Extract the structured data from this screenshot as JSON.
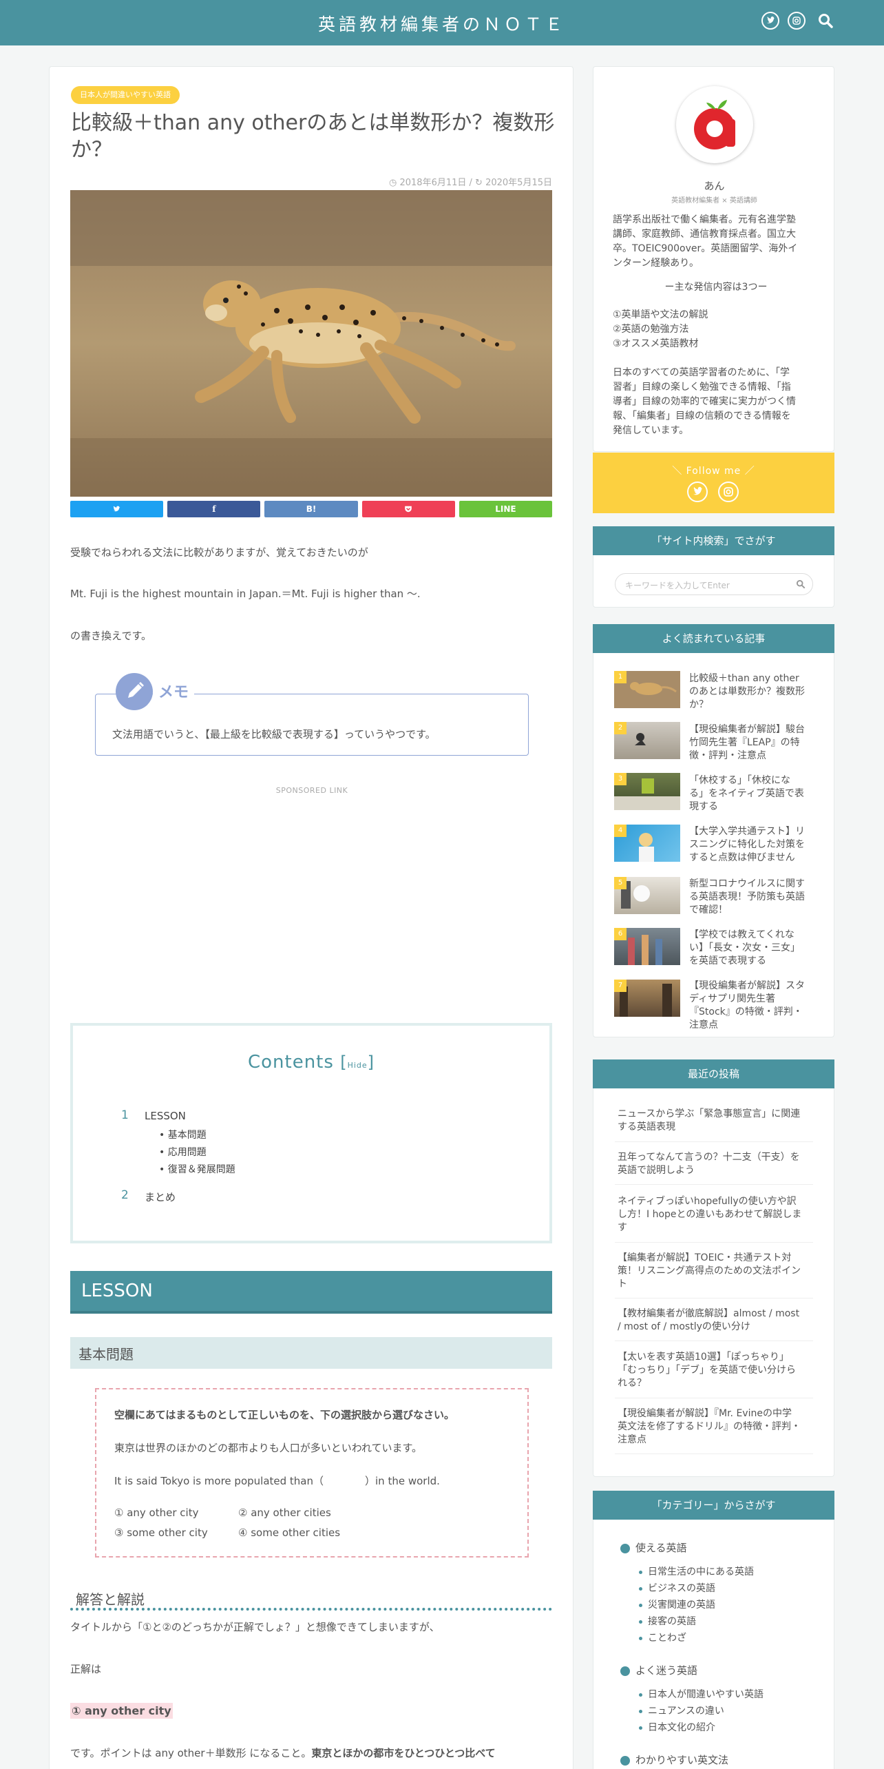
{
  "header": {
    "site_title": "英語教材編集者のＮＯＴＥ",
    "icons": [
      "twitter-icon",
      "instagram-icon",
      "search-icon"
    ]
  },
  "post": {
    "category": "日本人が間違いやすい英語",
    "title_line1": "比較級＋than any otherのあとは単数形か？複数形",
    "title_line2": "か？",
    "published": "2018年6月11日",
    "updated": "2020年5月15日",
    "share": [
      {
        "label": "",
        "icon": "twitter-icon",
        "color": "#1da1f2"
      },
      {
        "label": "",
        "icon": "facebook-icon",
        "color": "#3b5998"
      },
      {
        "label": "B!",
        "icon": "hatena-icon",
        "color": "#5d8ac1"
      },
      {
        "label": "",
        "icon": "pocket-icon",
        "color": "#ef4056"
      },
      {
        "label": "LINE",
        "icon": "line-icon",
        "color": "#6ac33b"
      }
    ],
    "intro1": "受験でねらわれる文法に比較がありますが、覚えておきたいのが",
    "intro2": "Mt. Fuji is the highest mountain in Japan.＝Mt. Fuji is higher than ～.",
    "intro3": "の書き換えです。",
    "memo_label": "メモ",
    "memo_text": "文法用語でいうと、【最上級を比較級で表現する】っていうやつです。",
    "sponsored": "SPONSORED LINK"
  },
  "toc": {
    "title": "Contents",
    "hide": "Hide",
    "items": [
      {
        "num": "1",
        "label": "LESSON",
        "subs": [
          "基本問題",
          "応用問題",
          "復習＆発展問題"
        ]
      },
      {
        "num": "2",
        "label": "まとめ",
        "subs": []
      }
    ]
  },
  "lesson": {
    "heading": "LESSON",
    "subheading": "基本問題",
    "question": "空欄にあてはまるものとして正しいものを、下の選択肢から選びなさい。",
    "sentence_jp": "東京は世界のほかのどの都市よりも人口が多いといわれています。",
    "sentence_en": "It is said Tokyo is more populated than（　　　　）in the world.",
    "choices": [
      "① any other city",
      "② any other cities",
      "③ some other city",
      "④ some other cities"
    ],
    "answer_heading": "解答と解説",
    "exp1": "タイトルから「①と②のどっちかが正解でしょ？」と想像できてしまいますが、",
    "exp2": "正解は",
    "answer": "① any other city",
    "exp3_normal": "です。ポイントは any other＋単数形 になること。",
    "exp3_bold": "東京とほかの都市をひとつひとつ比べて"
  },
  "sidebar": {
    "profile": {
      "name": "あん",
      "role": "英語教材編集者 × 英語講師",
      "bio": [
        "語学系出版社で働く編集者。元有名進学塾",
        "講師、家庭教師、通信教育採点者。国立大",
        "卒。TOEIC900over。英語圏留学、海外イ",
        "ンターン経験あり。"
      ],
      "main_title": "ー主な発信内容は3つー",
      "points": [
        "①英単語や文法の解説",
        "②英語の勉強方法",
        "③オススメ英語教材"
      ],
      "mission": [
        "日本のすべての英語学習者のために、「学",
        "習者」目線の楽しく勉強できる情報、「指",
        "導者」目線の効率的で確実に実力がつく情",
        "報、「編集者」目線の信頼のできる情報を",
        "発信しています。"
      ],
      "follow": "＼ Follow me ／"
    },
    "search": {
      "heading": "「サイト内検索」でさがす",
      "placeholder": "キーワードを入力してEnter"
    },
    "popular": {
      "heading": "よく読まれている記事",
      "items": [
        {
          "rank": "1",
          "lines": [
            "比較級＋than any other",
            "のあとは単数形か？複数形",
            "か？"
          ]
        },
        {
          "rank": "2",
          "lines": [
            "【現役編集者が解説】駿台",
            "竹岡先生著『LEAP』の特",
            "徴・評判・注意点"
          ]
        },
        {
          "rank": "3",
          "lines": [
            "「休校する」「休校にな",
            "る」をネイティブ英語で表",
            "現する"
          ]
        },
        {
          "rank": "4",
          "lines": [
            "【大学入学共通テスト】リ",
            "スニングに特化した対策を",
            "すると点数は伸びません"
          ]
        },
        {
          "rank": "5",
          "lines": [
            "新型コロナウイルスに関す",
            "る英語表現！予防策も英語",
            "で確認！"
          ]
        },
        {
          "rank": "6",
          "lines": [
            "【学校では教えてくれな",
            "い】「長女・次女・三女」",
            "を英語で表現する"
          ]
        },
        {
          "rank": "7",
          "lines": [
            "【現役編集者が解説】スタ",
            "ディサプリ関先生著",
            "『Stock』の特徴・評判・",
            "注意点"
          ]
        }
      ]
    },
    "recent": {
      "heading": "最近の投稿",
      "items": [
        [
          "ニュースから学ぶ「緊急事態宣言」に関連",
          "する英語表現"
        ],
        [
          "丑年ってなんて言うの？十二支（干支）を",
          "英語で説明しよう"
        ],
        [
          "ネイティブっぽいhopefullyの使い方や訳",
          "し方！I hopeとの違いもあわせて解説しま",
          "す"
        ],
        [
          "【編集者が解説】TOEIC・共通テスト対",
          "策！リスニング高得点のための文法ポイン",
          "ト"
        ],
        [
          "【教材編集者が徹底解説】almost / most",
          "/ most of / mostlyの使い分け"
        ],
        [
          "【太いを表す英語10選】「ぽっちゃり」",
          "「むっちり」「デブ」を英語で使い分けら",
          "れる？"
        ],
        [
          "【現役編集者が解説】『Mr. Evineの中学",
          "英文法を修了するドリル』の特徴・評判・",
          "注意点"
        ]
      ]
    },
    "categories": {
      "heading": "「カテゴリー」からさがす",
      "groups": [
        {
          "name": "使える英語",
          "subs": [
            "日常生活の中にある英語",
            "ビジネスの英語",
            "災害関連の英語",
            "接客の英語",
            "ことわざ"
          ]
        },
        {
          "name": "よく迷う英語",
          "subs": [
            "日本人が間違いやすい英語",
            "ニュアンスの違い",
            "日本文化の紹介"
          ]
        },
        {
          "name": "わかりやすい英文法",
          "subs": []
        }
      ]
    }
  },
  "colors": {
    "teal": "#4a939f",
    "yellow": "#fcd040",
    "pink": "#e8a4ad",
    "memo_blue": "#8fa4d6"
  }
}
